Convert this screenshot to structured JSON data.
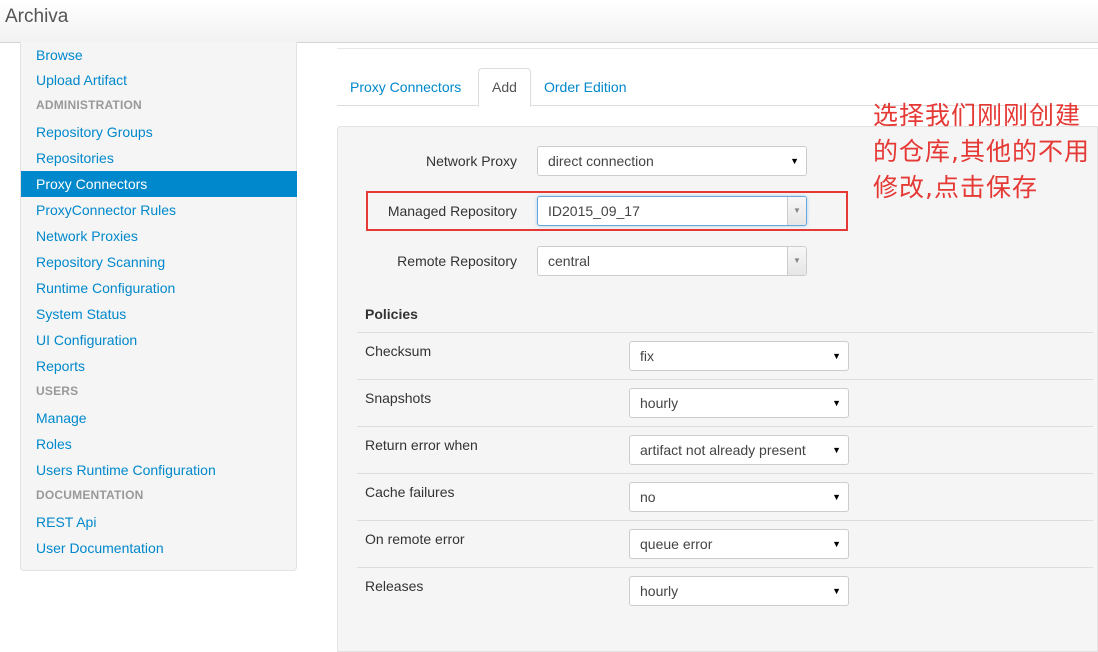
{
  "app": {
    "title": "Archiva"
  },
  "sidebar": {
    "items": [
      {
        "type": "link",
        "label": "Browse"
      },
      {
        "type": "link",
        "label": "Upload Artifact"
      },
      {
        "type": "header",
        "label": "ADMINISTRATION"
      },
      {
        "type": "link",
        "label": "Repository Groups"
      },
      {
        "type": "link",
        "label": "Repositories"
      },
      {
        "type": "link",
        "label": "Proxy Connectors",
        "active": true
      },
      {
        "type": "link",
        "label": "ProxyConnector Rules"
      },
      {
        "type": "link",
        "label": "Network Proxies"
      },
      {
        "type": "link",
        "label": "Repository Scanning"
      },
      {
        "type": "link",
        "label": "Runtime Configuration"
      },
      {
        "type": "link",
        "label": "System Status"
      },
      {
        "type": "link",
        "label": "UI Configuration"
      },
      {
        "type": "link",
        "label": "Reports"
      },
      {
        "type": "header",
        "label": "USERS"
      },
      {
        "type": "link",
        "label": "Manage"
      },
      {
        "type": "link",
        "label": "Roles"
      },
      {
        "type": "link",
        "label": "Users Runtime Configuration"
      },
      {
        "type": "header",
        "label": "DOCUMENTATION"
      },
      {
        "type": "link",
        "label": "REST Api"
      },
      {
        "type": "link",
        "label": "User Documentation"
      }
    ]
  },
  "tabs": [
    {
      "label": "Proxy Connectors",
      "active": false
    },
    {
      "label": "Add",
      "active": true
    },
    {
      "label": "Order Edition",
      "active": false
    }
  ],
  "form": {
    "network_proxy": {
      "label": "Network Proxy",
      "value": "direct connection"
    },
    "managed_repository": {
      "label": "Managed Repository",
      "value": "ID2015_09_17"
    },
    "remote_repository": {
      "label": "Remote Repository",
      "value": "central"
    }
  },
  "policies": {
    "title": "Policies",
    "rows": [
      {
        "label": "Checksum",
        "value": "fix"
      },
      {
        "label": "Snapshots",
        "value": "hourly"
      },
      {
        "label": "Return error when",
        "value": "artifact not already present"
      },
      {
        "label": "Cache failures",
        "value": "no"
      },
      {
        "label": "On remote error",
        "value": "queue error"
      },
      {
        "label": "Releases",
        "value": "hourly"
      }
    ]
  },
  "annotation": {
    "text": "选择我们刚刚创建的仓库,其他的不用修改,点击保存",
    "color": "#e53935"
  },
  "colors": {
    "accent": "#0088cc",
    "highlight": "#e53935"
  }
}
